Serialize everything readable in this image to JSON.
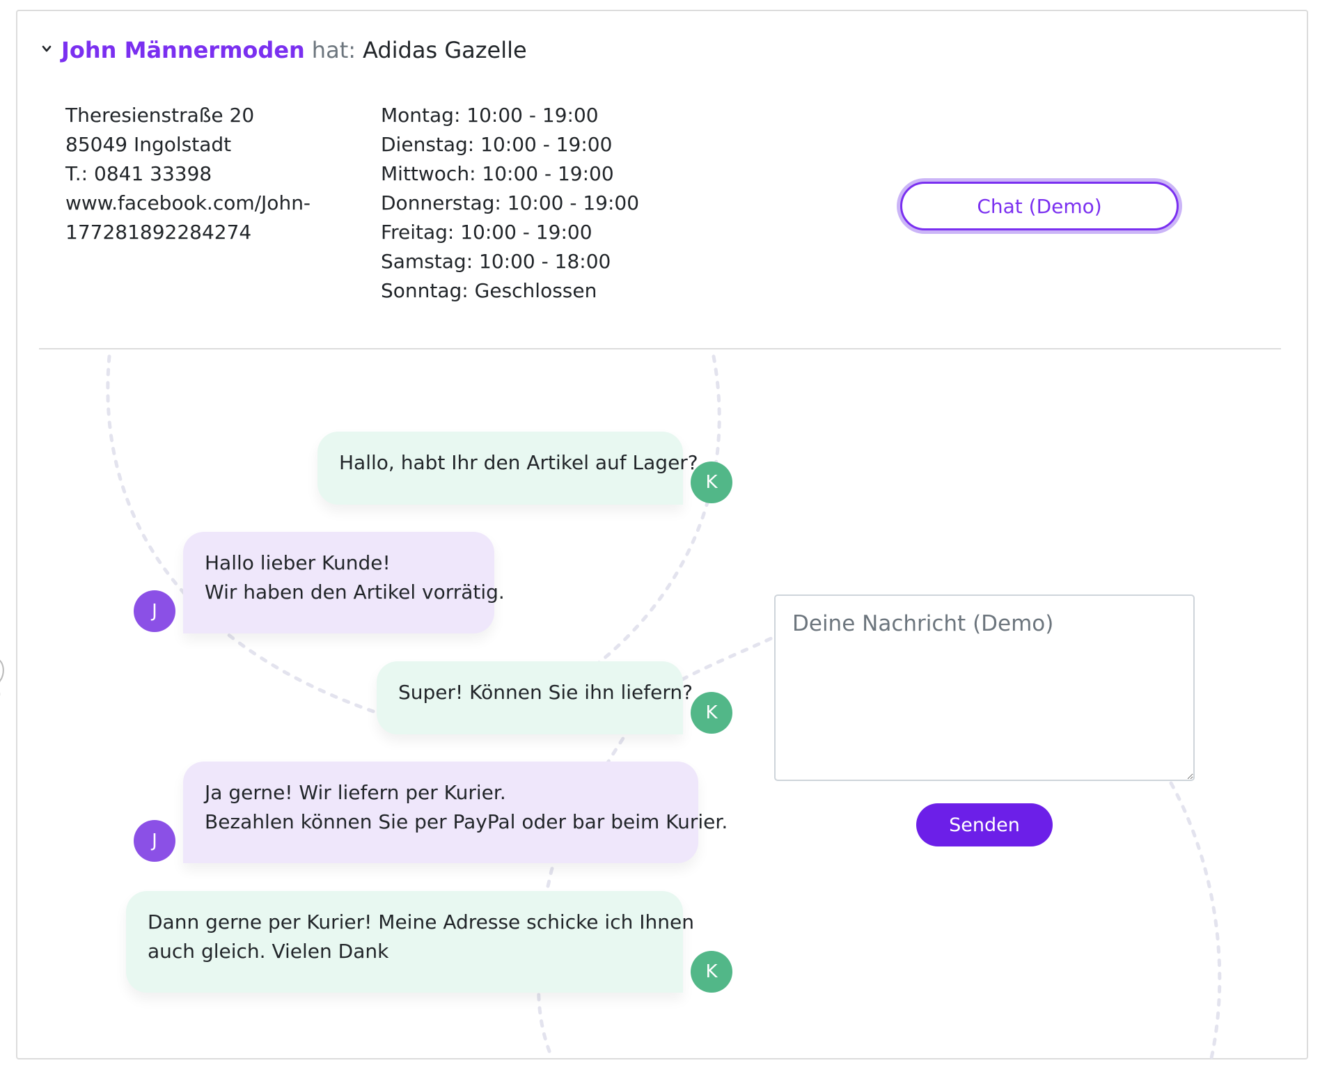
{
  "header": {
    "shop_name": "John Männermoden",
    "hat_label": "hat:",
    "product": "Adidas Gazelle"
  },
  "address": {
    "lines": [
      "Theresienstraße 20",
      "85049 Ingolstadt",
      "T.: 0841 33398",
      "www.facebook.com/John-",
      "177281892284274"
    ]
  },
  "hours": {
    "lines": [
      "Montag: 10:00 - 19:00",
      "Dienstag: 10:00 - 19:00",
      "Mittwoch: 10:00 - 19:00",
      "Donnerstag: 10:00 - 19:00",
      "Freitag: 10:00 - 19:00",
      "Samstag: 10:00 - 18:00",
      "Sonntag: Geschlossen"
    ]
  },
  "chat_button_label": "Chat (Demo)",
  "messages": [
    {
      "sender": "K",
      "lines": [
        "Hallo, habt Ihr den Artikel auf Lager?"
      ]
    },
    {
      "sender": "J",
      "lines": [
        "Hallo lieber Kunde!",
        "Wir haben den Artikel vorrätig."
      ]
    },
    {
      "sender": "K",
      "lines": [
        "Super! Können Sie ihn liefern?"
      ]
    },
    {
      "sender": "J",
      "lines": [
        "Ja gerne! Wir liefern per Kurier.",
        "Bezahlen können Sie per PayPal oder bar beim Kurier."
      ]
    },
    {
      "sender": "K",
      "lines": [
        "Dann gerne per Kurier! Meine Adresse schicke ich Ihnen",
        "auch gleich. Vielen Dank"
      ]
    }
  ],
  "composer": {
    "placeholder": "Deine Nachricht (Demo)",
    "send_label": "Senden"
  },
  "colors": {
    "accent": "#7a2ff0",
    "customer_bubble": "#e8f8f1",
    "shop_bubble": "#efe7fb",
    "customer_avatar": "#52b788",
    "shop_avatar": "#8b50e6",
    "send_button": "#6c1fe8"
  },
  "icons": {
    "collapse": "chevron-down-icon",
    "textarea_resize": "resize-grip-icon"
  }
}
